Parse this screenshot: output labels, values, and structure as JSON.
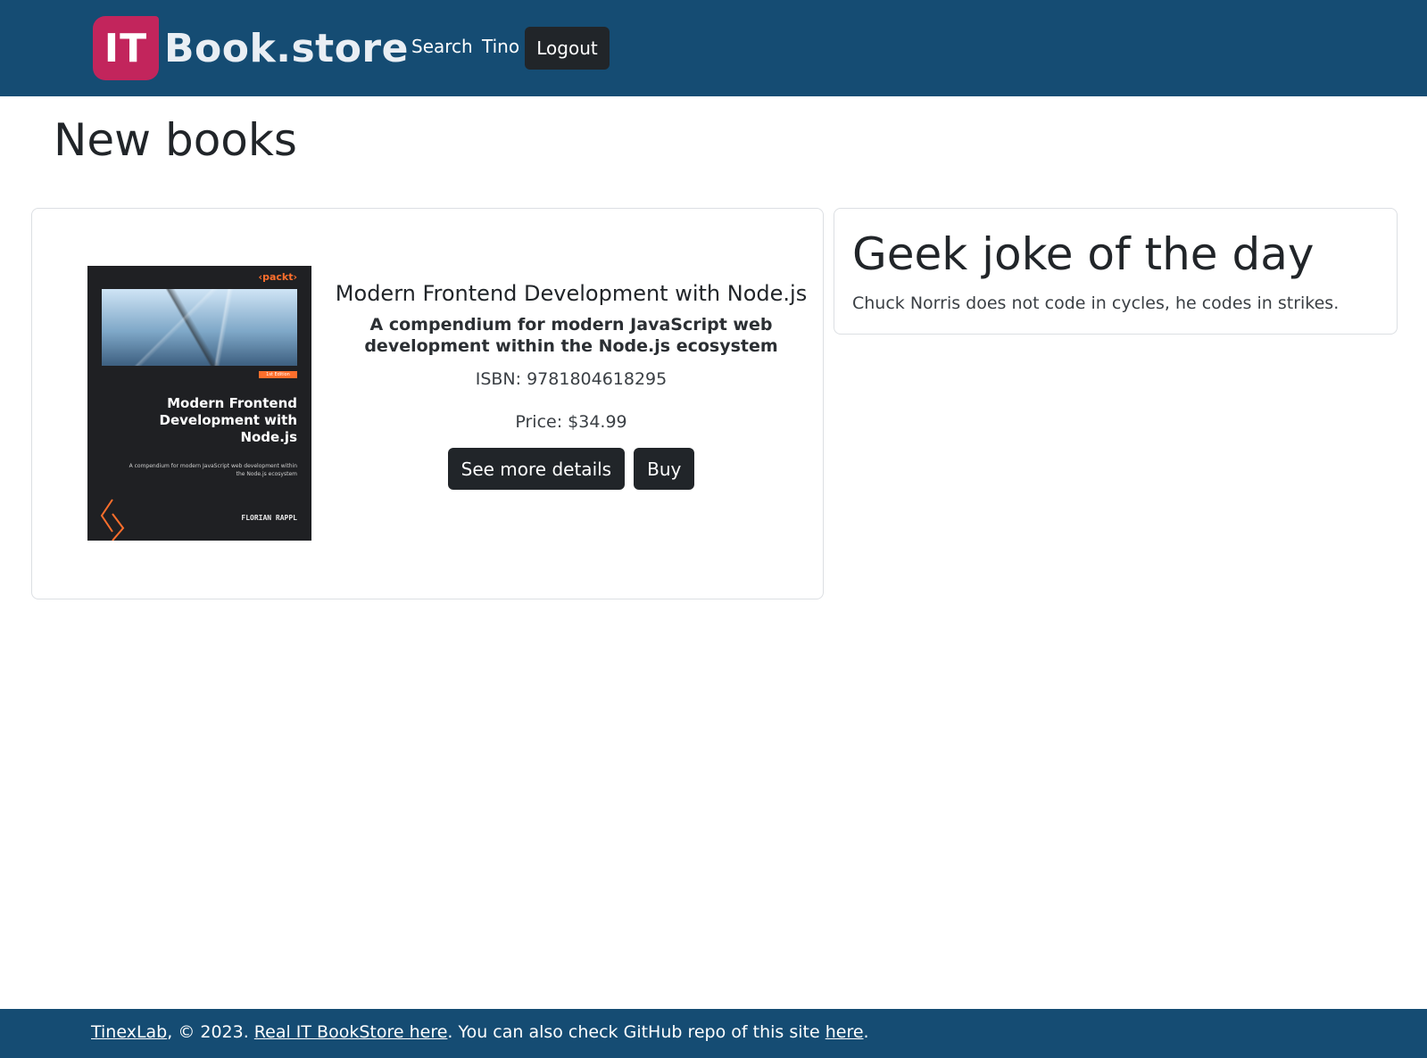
{
  "header": {
    "logo_badge": "IT",
    "logo_text": "Book.store",
    "nav": {
      "search_label": "Search",
      "user_label": "Tino",
      "logout_label": "Logout"
    }
  },
  "main": {
    "page_title": "New books",
    "book": {
      "cover": {
        "publisher": "‹packt›",
        "edition": "1st Edition",
        "title": "Modern Frontend Development with Node.js",
        "subtitle": "A compendium for modern JavaScript web development within the Node.js ecosystem",
        "author": "FLORIAN RAPPL"
      },
      "title": "Modern Frontend Development with Node.js",
      "subtitle": "A compendium for modern JavaScript web development within the Node.js ecosystem",
      "isbn": "ISBN: 9781804618295",
      "price": "Price: $34.99",
      "details_button": "See more details",
      "buy_button": "Buy"
    },
    "joke": {
      "title": "Geek joke of the day",
      "text": "Chuck Norris does not code in cycles, he codes in strikes."
    }
  },
  "footer": {
    "author_link": "TinexLab",
    "copyright": ", © 2023. ",
    "store_link": "Real IT BookStore here",
    "repo_text": ". You can also check GitHub repo of this site ",
    "repo_link": "here",
    "end": "."
  },
  "colors": {
    "navbar": "#154c73",
    "logo_badge": "#c2255c",
    "button_dark": "#212529",
    "cover_accent": "#ff6f2c"
  }
}
